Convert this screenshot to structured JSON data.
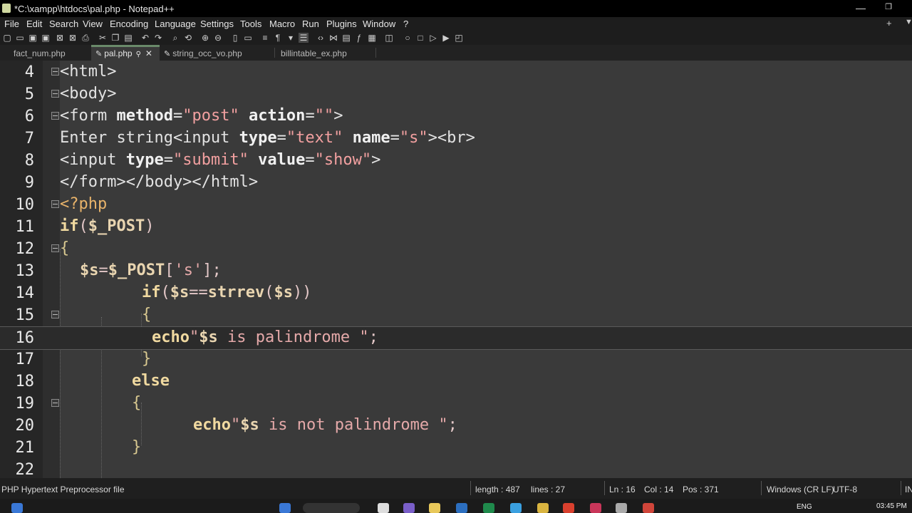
{
  "window": {
    "title": "*C:\\xampp\\htdocs\\pal.php - Notepad++",
    "minimize": "—",
    "restore": "❐"
  },
  "menu": {
    "items": [
      "File",
      "Edit",
      "Search",
      "View",
      "Encoding",
      "Language",
      "Settings",
      "Tools",
      "Macro",
      "Run",
      "Plugins",
      "Window",
      "?"
    ],
    "plus": "+",
    "down": "▼"
  },
  "tabs": [
    {
      "label": "fact_num.php"
    },
    {
      "label": "pal.php",
      "pen": "✎",
      "pin": "📌",
      "close": "✕"
    },
    {
      "label": "string_occ_vo.php",
      "pen": "✎"
    },
    {
      "label": "billintable_ex.php"
    }
  ],
  "lines": [
    {
      "n": "4"
    },
    {
      "n": "5"
    },
    {
      "n": "6"
    },
    {
      "n": "7"
    },
    {
      "n": "8"
    },
    {
      "n": "9"
    },
    {
      "n": "10"
    },
    {
      "n": "11"
    },
    {
      "n": "12"
    },
    {
      "n": "13"
    },
    {
      "n": "14"
    },
    {
      "n": "15"
    },
    {
      "n": "16"
    },
    {
      "n": "17"
    },
    {
      "n": "18"
    },
    {
      "n": "19"
    },
    {
      "n": "20"
    },
    {
      "n": "21"
    },
    {
      "n": "22"
    }
  ],
  "status": {
    "filetype": "PHP Hypertext Preprocessor file",
    "length": "length : 487",
    "lines": "lines : 27",
    "ln": "Ln : 16",
    "col": "Col : 14",
    "pos": "Pos : 371",
    "eol": "Windows (CR LF)",
    "enc": "UTF-8",
    "ins": "IN"
  },
  "taskbar": {
    "lang": "ENG",
    "time": "03:45 PM"
  }
}
